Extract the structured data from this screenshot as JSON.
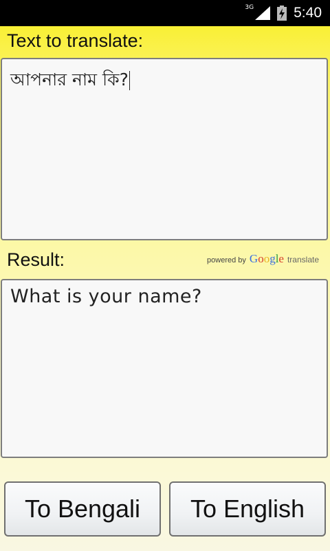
{
  "status_bar": {
    "network": "3G",
    "time": "5:40"
  },
  "source": {
    "label": "Text to translate:",
    "value": "আপনার নাম কি?"
  },
  "result": {
    "label": "Result:",
    "value": "What is your name?",
    "attribution": {
      "powered_by": "powered by",
      "google_letters": [
        "G",
        "o",
        "o",
        "g",
        "l",
        "e"
      ],
      "google_colors": [
        "#3b6fe0",
        "#d8402c",
        "#e9b526",
        "#3b6fe0",
        "#2f9c45",
        "#d8402c"
      ],
      "translate": "translate"
    }
  },
  "buttons": {
    "to_bengali": "To Bengali",
    "to_english": "To English"
  }
}
